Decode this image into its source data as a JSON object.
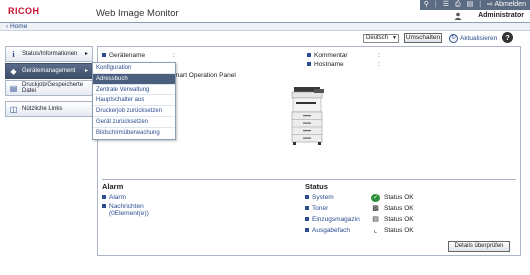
{
  "header": {
    "brand": "RICOH",
    "title": "Web Image Monitor",
    "logout_label": "Abmelden",
    "user_name": "Administrator",
    "toolbar_icons": [
      "search-icon",
      "list-icon",
      "printer-icon",
      "document-icon",
      "user-icon"
    ]
  },
  "breadcrumb": {
    "home_label": "Home"
  },
  "toolbar": {
    "language_value": "Deutsch",
    "switch_label": "Umschalten",
    "refresh_label": "Aktualisieren",
    "help_label": "?"
  },
  "sidebar": {
    "items": [
      {
        "label": "Status/Informationen",
        "icon": "info-icon",
        "arrow": "▸"
      },
      {
        "label": "Gerätemanagement",
        "icon": "settings-icon",
        "arrow": "▸"
      },
      {
        "label": "Druckjob/Gespeicherte Datei",
        "icon": "document-icon",
        "arrow": ""
      },
      {
        "label": "Nützliche Links",
        "icon": "links-icon",
        "arrow": ""
      }
    ]
  },
  "dropdown": {
    "items": [
      "Konfiguration",
      "Adressbuch",
      "Zentrale Verwaltung",
      "Hauptschalter aus",
      "Druckerjob zurücksetzen",
      "Gerät zurücksetzen",
      "Bildschirmüberwachung"
    ],
    "highlighted_index": 1
  },
  "device_info": {
    "device_name_label": "Gerätename",
    "device_name_value": ":",
    "comment_label": "Kommentar",
    "comment_value": ":",
    "hostname_label": "Hostname",
    "hostname_value": ":",
    "operation_panel_text": "mart Operation Panel"
  },
  "alarm": {
    "title": "Alarm",
    "items": [
      "Alarm",
      "Nachrichten",
      "(0Element(e))"
    ]
  },
  "status": {
    "title": "Status",
    "rows": [
      {
        "label": "System",
        "icon": "system-ok-icon",
        "value": "Status OK"
      },
      {
        "label": "Toner",
        "icon": "toner-icon",
        "value": "Status OK"
      },
      {
        "label": "Einzugsmagazin",
        "icon": "tray-icon",
        "value": "Status OK"
      },
      {
        "label": "Ausgabefach",
        "icon": "output-tray-icon",
        "value": "Status OK"
      }
    ],
    "details_label": "Details überprüfen"
  }
}
